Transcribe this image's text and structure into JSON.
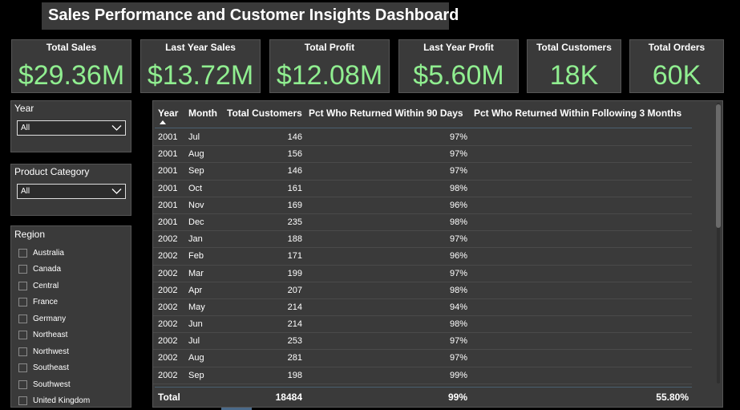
{
  "dashboard": {
    "title": "Sales Performance and Customer Insights Dashboard"
  },
  "kpis": [
    {
      "label": "Total Sales",
      "value": "$29.36M"
    },
    {
      "label": "Last Year Sales",
      "value": "$13.72M"
    },
    {
      "label": "Total Profit",
      "value": "$12.08M"
    },
    {
      "label": "Last Year Profit",
      "value": "$5.60M"
    },
    {
      "label": "Total Customers",
      "value": "18K"
    },
    {
      "label": "Total Orders",
      "value": "60K"
    }
  ],
  "slicers": {
    "year": {
      "title": "Year",
      "selected": "All"
    },
    "category": {
      "title": "Product Category",
      "selected": "All"
    },
    "region": {
      "title": "Region",
      "options": [
        "Australia",
        "Canada",
        "Central",
        "France",
        "Germany",
        "Northeast",
        "Northwest",
        "Southeast",
        "Southwest",
        "United Kingdom"
      ]
    }
  },
  "table": {
    "headers": [
      "Year",
      "Month",
      "Total Customers",
      "Pct Who Returned Within 90 Days",
      "Pct Who Returned Within Following 3 Months"
    ],
    "rows": [
      [
        "2001",
        "Jul",
        "146",
        "97%",
        ""
      ],
      [
        "2001",
        "Aug",
        "156",
        "97%",
        ""
      ],
      [
        "2001",
        "Sep",
        "146",
        "97%",
        ""
      ],
      [
        "2001",
        "Oct",
        "161",
        "98%",
        ""
      ],
      [
        "2001",
        "Nov",
        "169",
        "96%",
        ""
      ],
      [
        "2001",
        "Dec",
        "235",
        "98%",
        ""
      ],
      [
        "2002",
        "Jan",
        "188",
        "97%",
        ""
      ],
      [
        "2002",
        "Feb",
        "171",
        "96%",
        ""
      ],
      [
        "2002",
        "Mar",
        "199",
        "97%",
        ""
      ],
      [
        "2002",
        "Apr",
        "207",
        "98%",
        ""
      ],
      [
        "2002",
        "May",
        "214",
        "94%",
        ""
      ],
      [
        "2002",
        "Jun",
        "214",
        "98%",
        ""
      ],
      [
        "2002",
        "Jul",
        "253",
        "97%",
        ""
      ],
      [
        "2002",
        "Aug",
        "281",
        "97%",
        ""
      ],
      [
        "2002",
        "Sep",
        "198",
        "99%",
        ""
      ]
    ],
    "total": {
      "label": "Total",
      "customers": "18484",
      "pct90": "99%",
      "pct3m": "55.80%"
    }
  },
  "colors": {
    "kpi_value": "#90ee90",
    "panel_bg": "#3a3a3a",
    "page_bg": "#000000"
  }
}
